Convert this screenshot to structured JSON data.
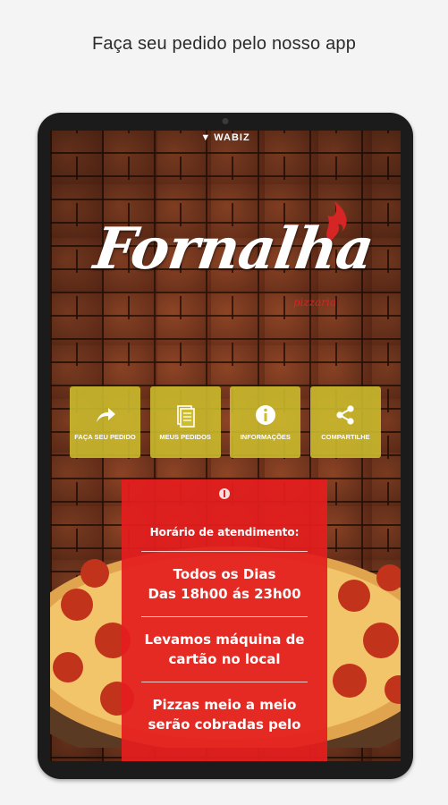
{
  "caption": "Faça seu pedido pelo nosso app",
  "app": {
    "brand_bar": "WABIZ",
    "logo_text": "Fornalha",
    "logo_sub": "pizzaria"
  },
  "tiles": [
    {
      "label": "FAÇA SEU PEDIDO",
      "icon": "share-arrow-icon"
    },
    {
      "label": "MEUS PEDIDOS",
      "icon": "document-icon"
    },
    {
      "label": "INFORMAÇÕES",
      "icon": "info-icon"
    },
    {
      "label": "COMPARTILHE",
      "icon": "share-icon"
    }
  ],
  "panel": {
    "heading": "Horário de atendimento:",
    "block1_line1": "Todos os Dias",
    "block1_line2": "Das 18h00 ás 23h00",
    "block2_line1": "Levamos máquina de",
    "block2_line2": "cartão no local",
    "block3_line1": "Pizzas meio a meio",
    "block3_line2": "serão cobradas pelo"
  },
  "colors": {
    "tile_bg": "#cdbe2d",
    "panel_bg": "#e41e1e",
    "accent_red": "#d62525"
  }
}
